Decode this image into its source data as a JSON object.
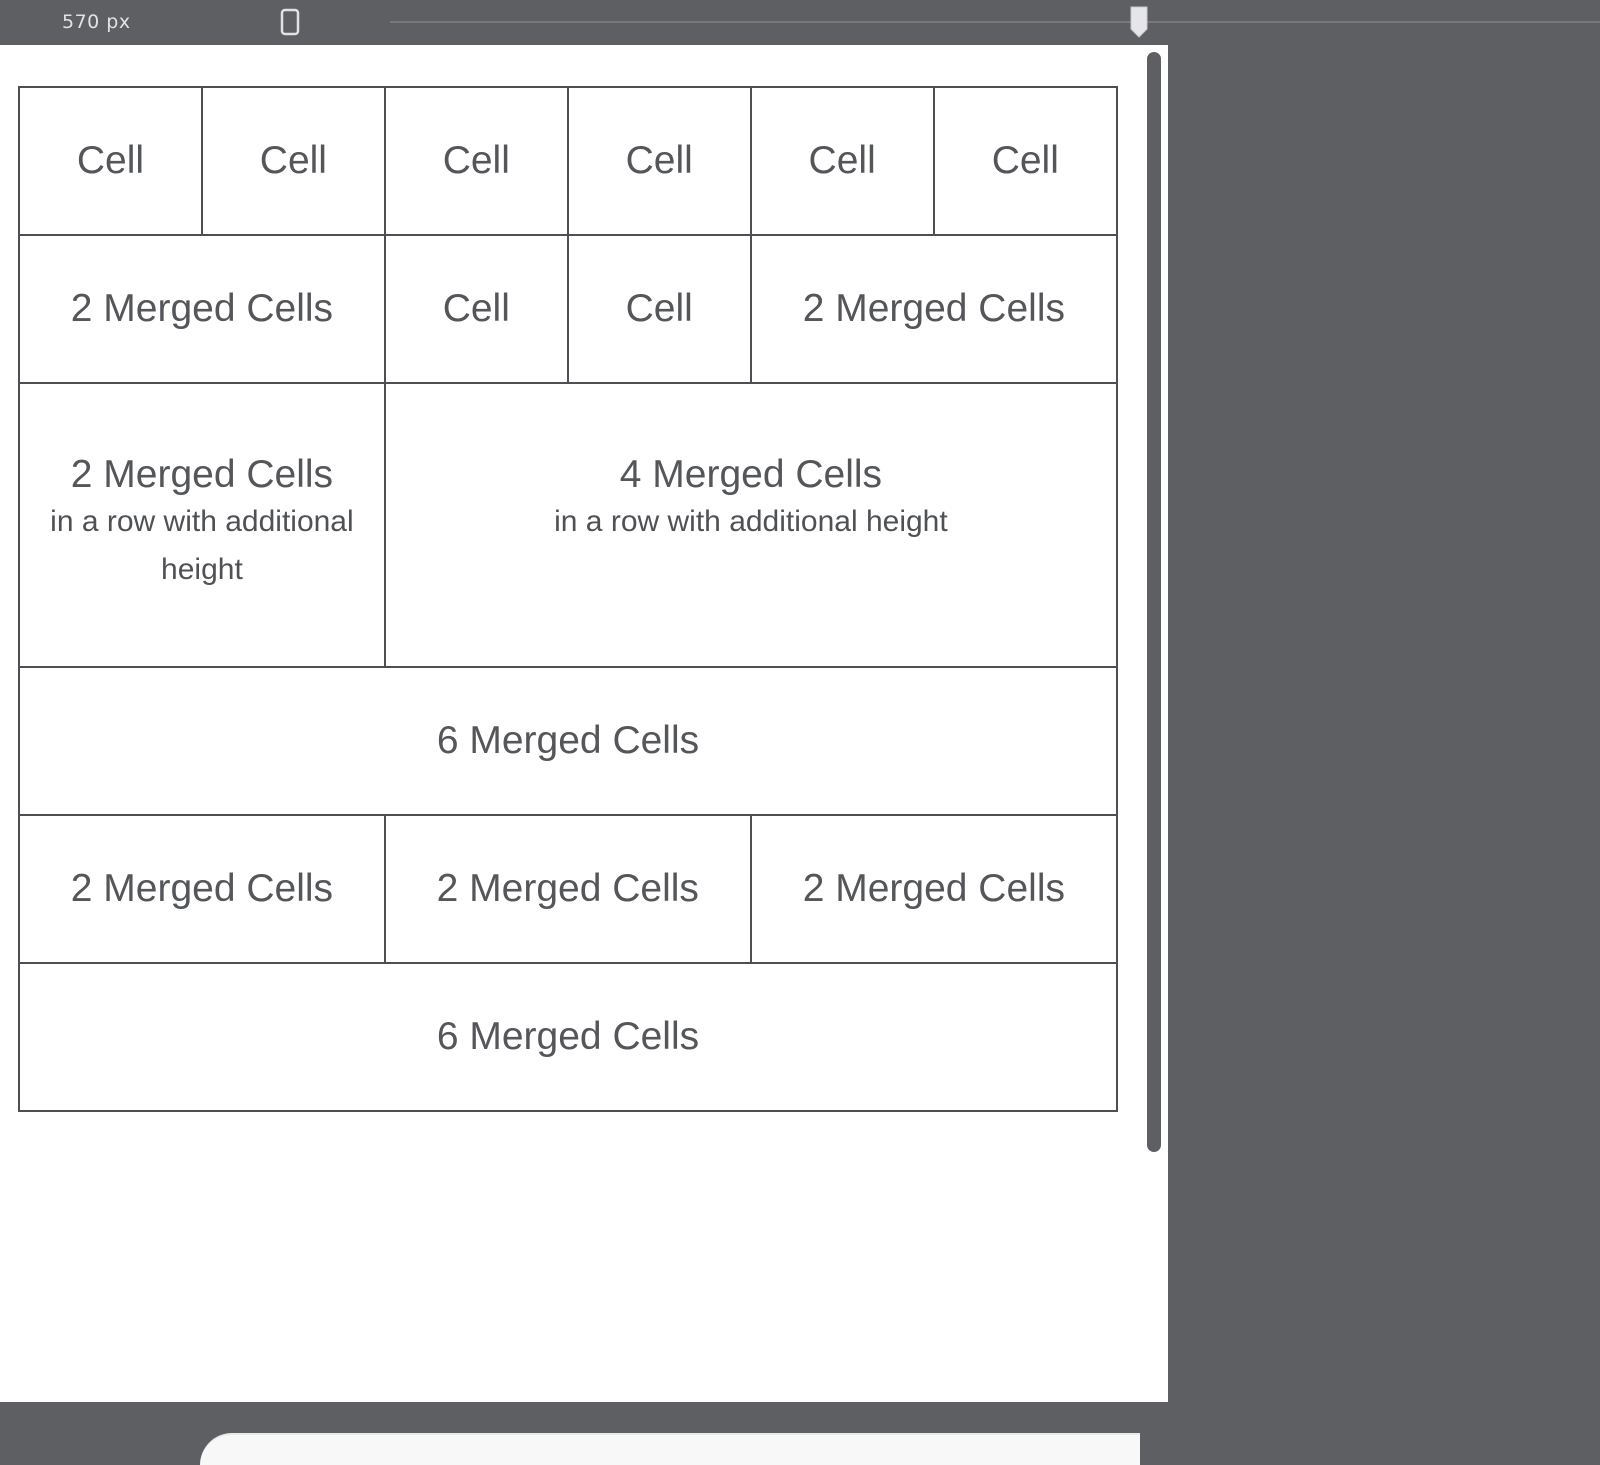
{
  "toolbar": {
    "width_readout": "570 px"
  },
  "table": {
    "rows": [
      {
        "type": "normal",
        "cells": [
          {
            "text": "Cell",
            "colspan": 1
          },
          {
            "text": "Cell",
            "colspan": 1
          },
          {
            "text": "Cell",
            "colspan": 1
          },
          {
            "text": "Cell",
            "colspan": 1
          },
          {
            "text": "Cell",
            "colspan": 1
          },
          {
            "text": "Cell",
            "colspan": 1
          }
        ]
      },
      {
        "type": "normal",
        "cells": [
          {
            "text": "2 Merged Cells",
            "colspan": 2
          },
          {
            "text": "Cell",
            "colspan": 1
          },
          {
            "text": "Cell",
            "colspan": 1
          },
          {
            "text": "2 Merged Cells",
            "colspan": 2
          }
        ]
      },
      {
        "type": "tall",
        "cells": [
          {
            "text": "2 Merged Cells",
            "subtext": "in a row with additional height",
            "colspan": 2
          },
          {
            "text": "4 Merged Cells",
            "subtext": "in a row with additional height",
            "colspan": 4
          }
        ]
      },
      {
        "type": "normal",
        "cells": [
          {
            "text": "6 Merged Cells",
            "colspan": 6
          }
        ]
      },
      {
        "type": "normal",
        "cells": [
          {
            "text": "2 Merged Cells",
            "colspan": 2
          },
          {
            "text": "2 Merged Cells",
            "colspan": 2
          },
          {
            "text": "2 Merged Cells",
            "colspan": 2
          }
        ]
      },
      {
        "type": "normal",
        "cells": [
          {
            "text": "6 Merged Cells",
            "colspan": 6
          }
        ]
      }
    ]
  },
  "colors": {
    "chrome_background": "#5e5f63",
    "page_background": "#ffffff",
    "cell_border": "#4e4f52",
    "cell_text": "#54565a"
  },
  "icons": {
    "device": "device-frame-icon",
    "slider": "width-slider-handle-icon"
  }
}
